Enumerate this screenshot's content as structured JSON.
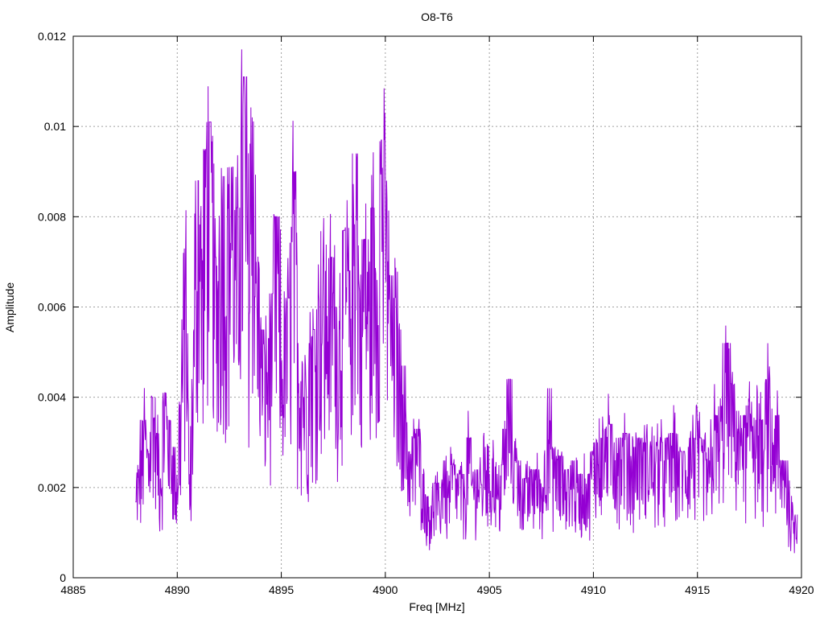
{
  "chart_data": {
    "type": "line",
    "title": "O8-T6",
    "xlabel": "Freq [MHz]",
    "ylabel": "Amplitude",
    "xlim": [
      4885,
      4920
    ],
    "ylim": [
      0,
      0.012
    ],
    "x_ticks": [
      "4885",
      "4890",
      "4895",
      "4900",
      "4905",
      "4910",
      "4915",
      "4920"
    ],
    "y_ticks": [
      "0",
      "0.002",
      "0.004",
      "0.006",
      "0.008",
      "0.01",
      "0.012"
    ],
    "grid": true,
    "legend": "none",
    "series_color": "#9400d3",
    "series": [
      {
        "x_start": 4888.0,
        "x_step": 0.2,
        "values": [
          0.0017,
          0.0025,
          0.0035,
          0.0028,
          0.004,
          0.0032,
          0.0022,
          0.0041,
          0.0035,
          0.0029,
          0.002,
          0.0044,
          0.0072,
          0.0015,
          0.0055,
          0.0088,
          0.0064,
          0.0095,
          0.0101,
          0.0067,
          0.0071,
          0.0089,
          0.0077,
          0.0091,
          0.0072,
          0.0082,
          0.0111,
          0.0076,
          0.0102,
          0.007,
          0.0055,
          0.0049,
          0.0053,
          0.0063,
          0.008,
          0.0046,
          0.0057,
          0.0062,
          0.009,
          0.0052,
          0.0048,
          0.0041,
          0.0052,
          0.0055,
          0.0063,
          0.0068,
          0.0058,
          0.0071,
          0.006,
          0.0055,
          0.0077,
          0.0068,
          0.0064,
          0.0094,
          0.006,
          0.0075,
          0.0059,
          0.0082,
          0.0066,
          0.0097,
          0.0088,
          0.0067,
          0.0062,
          0.0055,
          0.0047,
          0.0035,
          0.0025,
          0.0031,
          0.0033,
          0.0023,
          0.0018,
          0.0016,
          0.0021,
          0.0017,
          0.0026,
          0.0019,
          0.0025,
          0.0022,
          0.0023,
          0.002,
          0.0031,
          0.0022,
          0.0024,
          0.0021,
          0.0029,
          0.0023,
          0.0027,
          0.0019,
          0.0025,
          0.0033,
          0.0044,
          0.0028,
          0.0026,
          0.0022,
          0.0021,
          0.0024,
          0.0024,
          0.0022,
          0.002,
          0.0042,
          0.0029,
          0.0025,
          0.0027,
          0.0023,
          0.0024,
          0.0026,
          0.0021,
          0.0023,
          0.0022,
          0.0023,
          0.0028,
          0.003,
          0.0031,
          0.0033,
          0.0034,
          0.003,
          0.0031,
          0.0029,
          0.0032,
          0.0027,
          0.0029,
          0.0031,
          0.003,
          0.0028,
          0.0029,
          0.0026,
          0.003,
          0.0026,
          0.0031,
          0.0032,
          0.0029,
          0.0028,
          0.0027,
          0.0029,
          0.0031,
          0.0031,
          0.0028,
          0.0026,
          0.0024,
          0.0036,
          0.0034,
          0.0038,
          0.0052,
          0.0043,
          0.0037,
          0.0033,
          0.0036,
          0.0031,
          0.0039,
          0.0035,
          0.0035,
          0.0028,
          0.0044,
          0.0025,
          0.0036,
          0.0022,
          0.0026,
          0.0018,
          0.0013,
          0.0014
        ]
      }
    ]
  }
}
